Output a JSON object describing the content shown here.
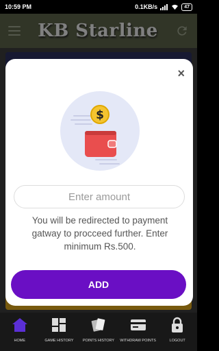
{
  "status_bar": {
    "time": "10:59 PM",
    "network": "0.1KB/s",
    "battery": "47"
  },
  "app_bar": {
    "title": "KB Starline",
    "menu_icon": "hamburger-menu-icon",
    "refresh_icon": "refresh-icon"
  },
  "modal": {
    "close_label": "×",
    "illustration_icon": "wallet-coin-icon",
    "amount_placeholder": "Enter amount",
    "message": "You will be redirected to payment gatway to procceed further. Enter minimum Rs.500.",
    "add_label": "ADD"
  },
  "bottom_nav": {
    "items": [
      {
        "label": "HOME",
        "icon": "home-icon"
      },
      {
        "label": "GAME HISTORY",
        "icon": "dashboard-icon"
      },
      {
        "label": "POINTS HISTORY",
        "icon": "cards-icon"
      },
      {
        "label": "WITHDRAW POINTS",
        "icon": "card-icon"
      },
      {
        "label": "LOGOUT",
        "icon": "lock-icon"
      }
    ]
  },
  "colors": {
    "app_bar": "#5a6148",
    "accent": "#6a0fc4",
    "home_active": "#5b2fd6"
  }
}
